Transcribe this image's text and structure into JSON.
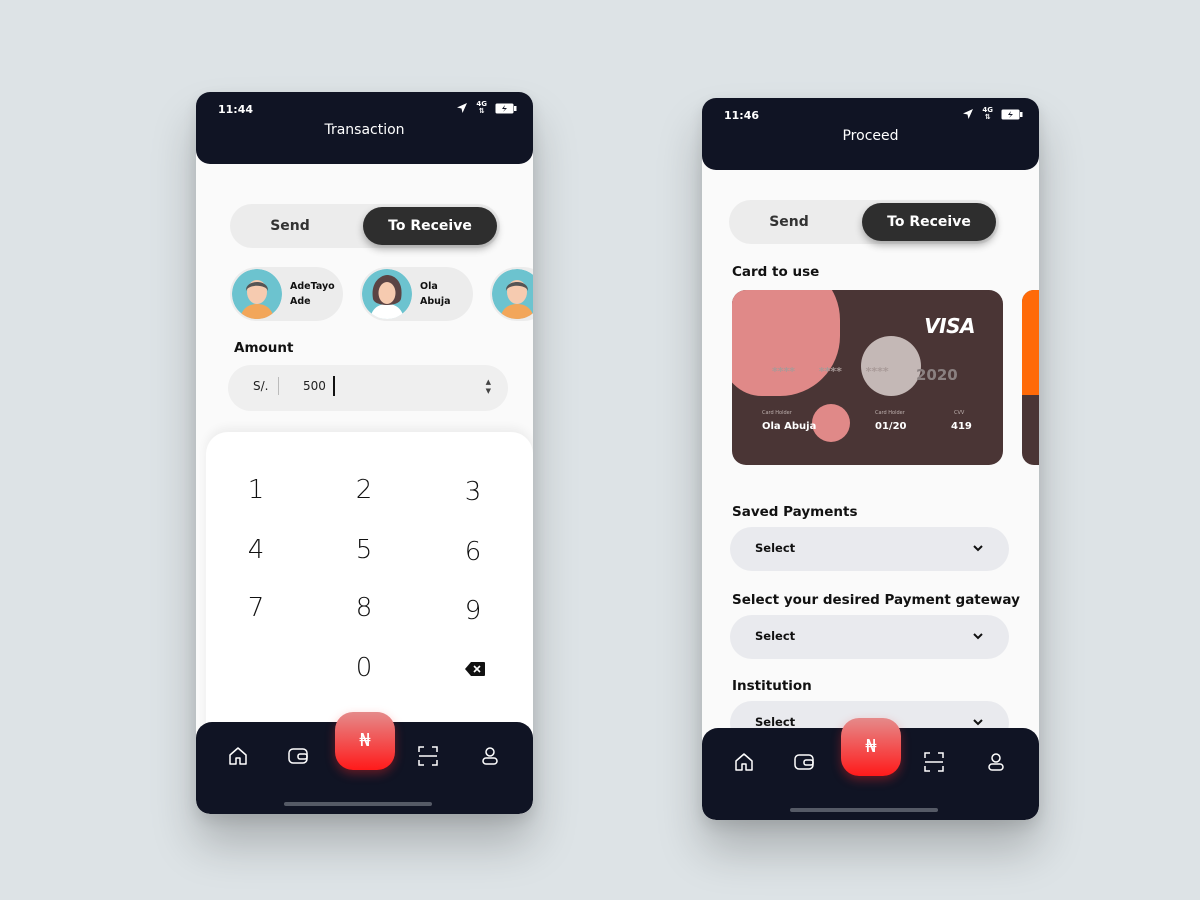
{
  "phone1": {
    "time": "11:44",
    "network": "4G",
    "title": "Transaction",
    "toggle": {
      "send": "Send",
      "receive": "To Receive"
    },
    "contacts": [
      {
        "first": "AdeTayo",
        "last": "Ade"
      },
      {
        "first": "Ola",
        "last": "Abuja"
      }
    ],
    "amount_label": "Amount",
    "currency": "S/.",
    "amount_value": "500",
    "keys": [
      "1",
      "2",
      "3",
      "4",
      "5",
      "6",
      "7",
      "8",
      "9",
      "0"
    ],
    "fab_symbol": "₦"
  },
  "phone2": {
    "time": "11:46",
    "network": "4G",
    "title": "Proceed",
    "toggle": {
      "send": "Send",
      "receive": "To Receive"
    },
    "card_label": "Card to use",
    "card": {
      "brand": "VISA",
      "masked": "**** **** ****",
      "last": "2020",
      "holder_caption": "Card Holder",
      "holder": "Ola Abuja",
      "expiry_caption": "Card Holder",
      "expiry": "01/20",
      "cvv_caption": "CVV",
      "cvv": "419"
    },
    "saved_payments_label": "Saved Payments",
    "saved_payments_value": "Select",
    "gateway_label": "Select your desired Payment gateway",
    "gateway_value": "Select",
    "institution_label": "Institution",
    "institution_value": "Select",
    "fab_symbol": "₦"
  },
  "colors": {
    "background": "#dde3e6",
    "header_navy": "#101424",
    "toggle_active": "#2e2e2e",
    "card_brown": "#4a3535",
    "card_pink": "#e08988",
    "fab_red": "#ff1a1a"
  },
  "icons": [
    "location-arrow-icon",
    "network-icon",
    "battery-icon",
    "home-icon",
    "wallet-icon",
    "naira-icon",
    "scan-icon",
    "profile-icon",
    "backspace-icon",
    "chevron-down-icon"
  ]
}
